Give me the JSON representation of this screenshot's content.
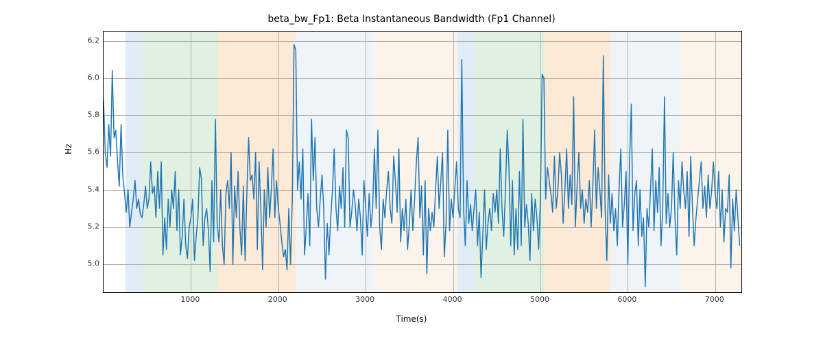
{
  "chart_data": {
    "type": "line",
    "title": "beta_bw_Fp1: Beta Instantaneous Bandwidth (Fp1 Channel)",
    "xlabel": "Time(s)",
    "ylabel": "Hz",
    "xlim": [
      0,
      7300
    ],
    "ylim": [
      4.85,
      6.25
    ],
    "xticks": [
      1000,
      2000,
      3000,
      4000,
      5000,
      6000,
      7000
    ],
    "yticks": [
      5.0,
      5.2,
      5.4,
      5.6,
      5.8,
      6.0,
      6.2
    ],
    "bands": [
      {
        "x0": 250,
        "x1": 450,
        "color": "blue"
      },
      {
        "x0": 450,
        "x1": 1300,
        "color": "green"
      },
      {
        "x0": 1300,
        "x1": 2200,
        "color": "orange"
      },
      {
        "x0": 2200,
        "x1": 3100,
        "color": "lightblue"
      },
      {
        "x0": 3100,
        "x1": 3300,
        "color": "lightorange"
      },
      {
        "x0": 3300,
        "x1": 4050,
        "color": "lightorange"
      },
      {
        "x0": 4050,
        "x1": 4250,
        "color": "blue"
      },
      {
        "x0": 4250,
        "x1": 5050,
        "color": "green"
      },
      {
        "x0": 5050,
        "x1": 5800,
        "color": "orange"
      },
      {
        "x0": 5800,
        "x1": 6600,
        "color": "lightblue"
      },
      {
        "x0": 6600,
        "x1": 7300,
        "color": "lightorange"
      }
    ],
    "x": [
      0,
      20,
      40,
      60,
      80,
      100,
      120,
      140,
      160,
      180,
      200,
      220,
      240,
      260,
      280,
      300,
      320,
      340,
      360,
      380,
      400,
      420,
      440,
      460,
      480,
      500,
      520,
      540,
      560,
      580,
      600,
      620,
      640,
      660,
      680,
      700,
      720,
      740,
      760,
      780,
      800,
      820,
      840,
      860,
      880,
      900,
      920,
      940,
      960,
      980,
      1000,
      1020,
      1040,
      1060,
      1080,
      1100,
      1120,
      1140,
      1160,
      1180,
      1200,
      1220,
      1240,
      1260,
      1280,
      1300,
      1320,
      1340,
      1360,
      1380,
      1400,
      1420,
      1440,
      1460,
      1480,
      1500,
      1520,
      1540,
      1560,
      1580,
      1600,
      1620,
      1640,
      1660,
      1680,
      1700,
      1720,
      1740,
      1760,
      1780,
      1800,
      1820,
      1840,
      1860,
      1880,
      1900,
      1920,
      1940,
      1960,
      1980,
      2000,
      2020,
      2040,
      2060,
      2080,
      2100,
      2120,
      2140,
      2160,
      2180,
      2200,
      2220,
      2240,
      2260,
      2280,
      2300,
      2320,
      2340,
      2360,
      2380,
      2400,
      2420,
      2440,
      2460,
      2480,
      2500,
      2520,
      2540,
      2560,
      2580,
      2600,
      2620,
      2640,
      2660,
      2680,
      2700,
      2720,
      2740,
      2760,
      2780,
      2800,
      2820,
      2840,
      2860,
      2880,
      2900,
      2920,
      2940,
      2960,
      2980,
      3000,
      3020,
      3040,
      3060,
      3080,
      3100,
      3120,
      3140,
      3160,
      3180,
      3200,
      3220,
      3240,
      3260,
      3280,
      3300,
      3320,
      3340,
      3360,
      3380,
      3400,
      3420,
      3440,
      3460,
      3480,
      3500,
      3520,
      3540,
      3560,
      3580,
      3600,
      3620,
      3640,
      3660,
      3680,
      3700,
      3720,
      3740,
      3760,
      3780,
      3800,
      3820,
      3840,
      3860,
      3880,
      3900,
      3920,
      3940,
      3960,
      3980,
      4000,
      4020,
      4040,
      4060,
      4080,
      4100,
      4120,
      4140,
      4160,
      4180,
      4200,
      4220,
      4240,
      4260,
      4280,
      4300,
      4320,
      4340,
      4360,
      4380,
      4400,
      4420,
      4440,
      4460,
      4480,
      4500,
      4520,
      4540,
      4560,
      4580,
      4600,
      4620,
      4640,
      4660,
      4680,
      4700,
      4720,
      4740,
      4760,
      4780,
      4800,
      4820,
      4840,
      4860,
      4880,
      4900,
      4920,
      4940,
      4960,
      4980,
      5000,
      5020,
      5040,
      5060,
      5080,
      5100,
      5120,
      5140,
      5160,
      5180,
      5200,
      5220,
      5240,
      5260,
      5280,
      5300,
      5320,
      5340,
      5360,
      5380,
      5400,
      5420,
      5440,
      5460,
      5480,
      5500,
      5520,
      5540,
      5560,
      5580,
      5600,
      5620,
      5640,
      5660,
      5680,
      5700,
      5720,
      5740,
      5760,
      5780,
      5800,
      5820,
      5840,
      5860,
      5880,
      5900,
      5920,
      5940,
      5960,
      5980,
      6000,
      6020,
      6040,
      6060,
      6080,
      6100,
      6120,
      6140,
      6160,
      6180,
      6200,
      6220,
      6240,
      6260,
      6280,
      6300,
      6320,
      6340,
      6360,
      6380,
      6400,
      6420,
      6440,
      6460,
      6480,
      6500,
      6520,
      6540,
      6560,
      6580,
      6600,
      6620,
      6640,
      6660,
      6680,
      6700,
      6720,
      6740,
      6760,
      6780,
      6800,
      6820,
      6840,
      6860,
      6880,
      6900,
      6920,
      6940,
      6960,
      6980,
      7000,
      7020,
      7040,
      7060,
      7080,
      7100,
      7120,
      7140,
      7160,
      7180,
      7200,
      7220,
      7240,
      7260,
      7280
    ],
    "values": [
      5.88,
      5.6,
      5.52,
      5.75,
      5.58,
      6.04,
      5.68,
      5.72,
      5.55,
      5.42,
      5.75,
      5.48,
      5.38,
      5.28,
      5.4,
      5.2,
      5.28,
      5.35,
      5.45,
      5.3,
      5.35,
      5.27,
      5.25,
      5.32,
      5.42,
      5.3,
      5.35,
      5.55,
      5.38,
      5.42,
      5.25,
      5.5,
      5.3,
      5.55,
      5.05,
      5.25,
      5.08,
      5.35,
      5.2,
      5.4,
      5.3,
      5.5,
      5.18,
      5.4,
      5.05,
      5.15,
      5.35,
      5.1,
      5.03,
      5.2,
      5.25,
      5.35,
      5.02,
      5.15,
      5.25,
      5.52,
      5.46,
      5.1,
      5.25,
      5.3,
      5.18,
      4.96,
      5.45,
      5.12,
      5.78,
      5.22,
      5.12,
      5.4,
      5.1,
      5.0,
      5.38,
      5.45,
      5.3,
      5.6,
      5.0,
      5.42,
      5.25,
      5.5,
      5.2,
      5.05,
      5.42,
      5.02,
      5.38,
      5.68,
      5.45,
      5.48,
      5.35,
      5.6,
      5.08,
      5.55,
      5.3,
      4.97,
      5.4,
      5.2,
      5.52,
      5.25,
      5.4,
      5.62,
      5.25,
      5.45,
      5.3,
      5.22,
      5.12,
      5.04,
      5.08,
      4.97,
      5.3,
      5.0,
      5.35,
      6.18,
      6.15,
      5.4,
      5.55,
      5.35,
      5.62,
      5.05,
      5.2,
      5.38,
      5.1,
      5.78,
      5.45,
      5.68,
      5.3,
      5.2,
      5.35,
      5.48,
      5.3,
      4.92,
      5.22,
      5.05,
      5.25,
      5.4,
      5.62,
      5.3,
      5.18,
      5.42,
      5.3,
      5.52,
      5.2,
      5.72,
      5.68,
      5.2,
      5.28,
      5.4,
      5.32,
      5.18,
      5.35,
      5.25,
      5.05,
      5.45,
      5.3,
      5.15,
      5.38,
      5.2,
      5.3,
      5.62,
      5.3,
      5.72,
      5.2,
      5.08,
      5.35,
      5.25,
      5.4,
      5.5,
      5.3,
      5.22,
      5.58,
      5.45,
      5.28,
      5.62,
      5.12,
      5.3,
      5.18,
      5.35,
      5.08,
      5.22,
      5.4,
      5.18,
      5.35,
      5.55,
      5.68,
      5.25,
      5.42,
      5.05,
      5.45,
      4.95,
      5.3,
      5.18,
      5.28,
      5.2,
      5.4,
      5.58,
      5.3,
      5.45,
      5.6,
      5.04,
      5.22,
      5.72,
      5.18,
      5.35,
      5.25,
      5.4,
      5.55,
      5.3,
      5.25,
      6.1,
      5.3,
      5.1,
      5.45,
      5.22,
      5.32,
      5.18,
      5.3,
      5.4,
      5.1,
      5.28,
      4.93,
      5.15,
      5.4,
      5.08,
      5.22,
      5.3,
      5.18,
      5.38,
      5.28,
      5.4,
      5.22,
      5.62,
      5.3,
      5.15,
      5.4,
      5.72,
      5.52,
      5.1,
      5.45,
      5.05,
      5.3,
      5.08,
      5.5,
      5.1,
      5.78,
      5.2,
      5.32,
      5.22,
      5.02,
      5.38,
      5.18,
      5.35,
      5.25,
      5.08,
      5.35,
      6.02,
      6.0,
      5.35,
      5.52,
      5.45,
      5.38,
      5.28,
      5.58,
      5.3,
      5.4,
      5.6,
      5.48,
      5.22,
      5.4,
      5.62,
      5.3,
      5.48,
      5.32,
      5.9,
      5.2,
      5.42,
      5.6,
      5.3,
      5.4,
      5.22,
      5.35,
      5.28,
      5.45,
      5.2,
      5.42,
      5.72,
      5.3,
      5.52,
      5.4,
      5.25,
      6.12,
      5.3,
      5.02,
      5.48,
      5.22,
      5.38,
      5.18,
      5.3,
      5.1,
      5.4,
      5.62,
      5.2,
      5.32,
      5.5,
      5.0,
      5.55,
      5.86,
      5.18,
      5.38,
      5.45,
      5.1,
      5.4,
      5.15,
      5.25,
      4.88,
      5.3,
      5.2,
      5.4,
      5.62,
      5.18,
      5.45,
      5.28,
      5.52,
      5.1,
      5.3,
      5.9,
      5.22,
      5.38,
      5.2,
      5.3,
      5.6,
      5.25,
      5.05,
      5.45,
      5.3,
      5.55,
      5.4,
      5.3,
      5.5,
      5.15,
      5.58,
      5.3,
      5.1,
      5.25,
      5.35,
      5.45,
      5.55,
      5.3,
      5.42,
      5.25,
      5.48,
      5.3,
      5.4,
      5.55,
      5.38,
      5.3,
      5.5,
      5.2,
      5.4,
      5.12,
      5.3,
      5.28,
      5.48,
      4.98,
      5.35,
      5.18,
      5.4,
      5.25,
      5.1
    ]
  }
}
